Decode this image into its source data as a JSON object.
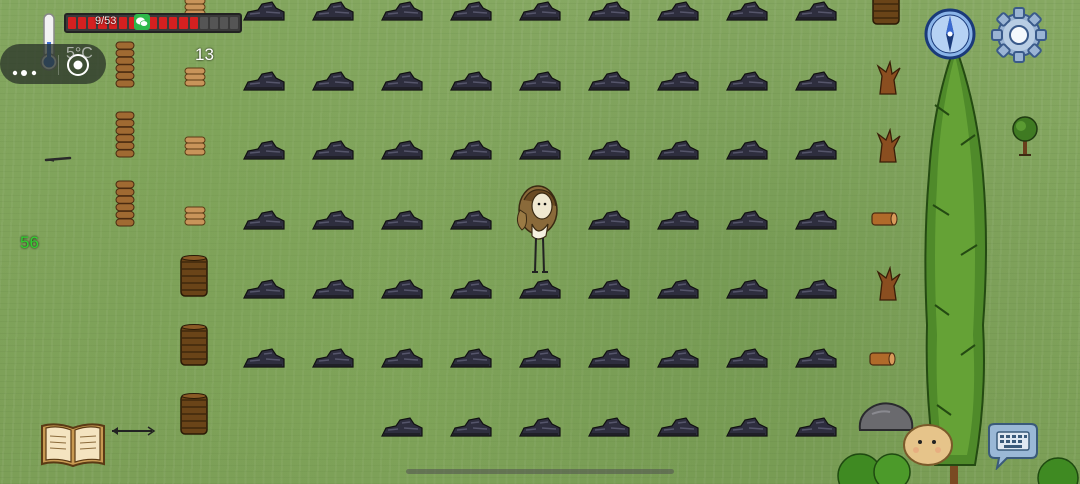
{
  "hud": {
    "temperature": "5°C",
    "food_value": "9/53",
    "health_segments_total": 17,
    "health_segments_filled": 13,
    "item_count": "13",
    "fps": "56"
  },
  "icons": {
    "thermometer": "thermometer-icon",
    "more": "more-dots-icon",
    "close": "target-close-icon",
    "compass": "compass-icon",
    "settings": "gear-icon",
    "keyboard": "keyboard-icon",
    "book": "recipe-book-icon",
    "wechat": "wechat-icon"
  },
  "colors": {
    "grass": "#7fa35a",
    "health": "#d52020",
    "fps": "#30d230",
    "stone": "#2e2e3e",
    "wood": "#8a5a2a"
  }
}
